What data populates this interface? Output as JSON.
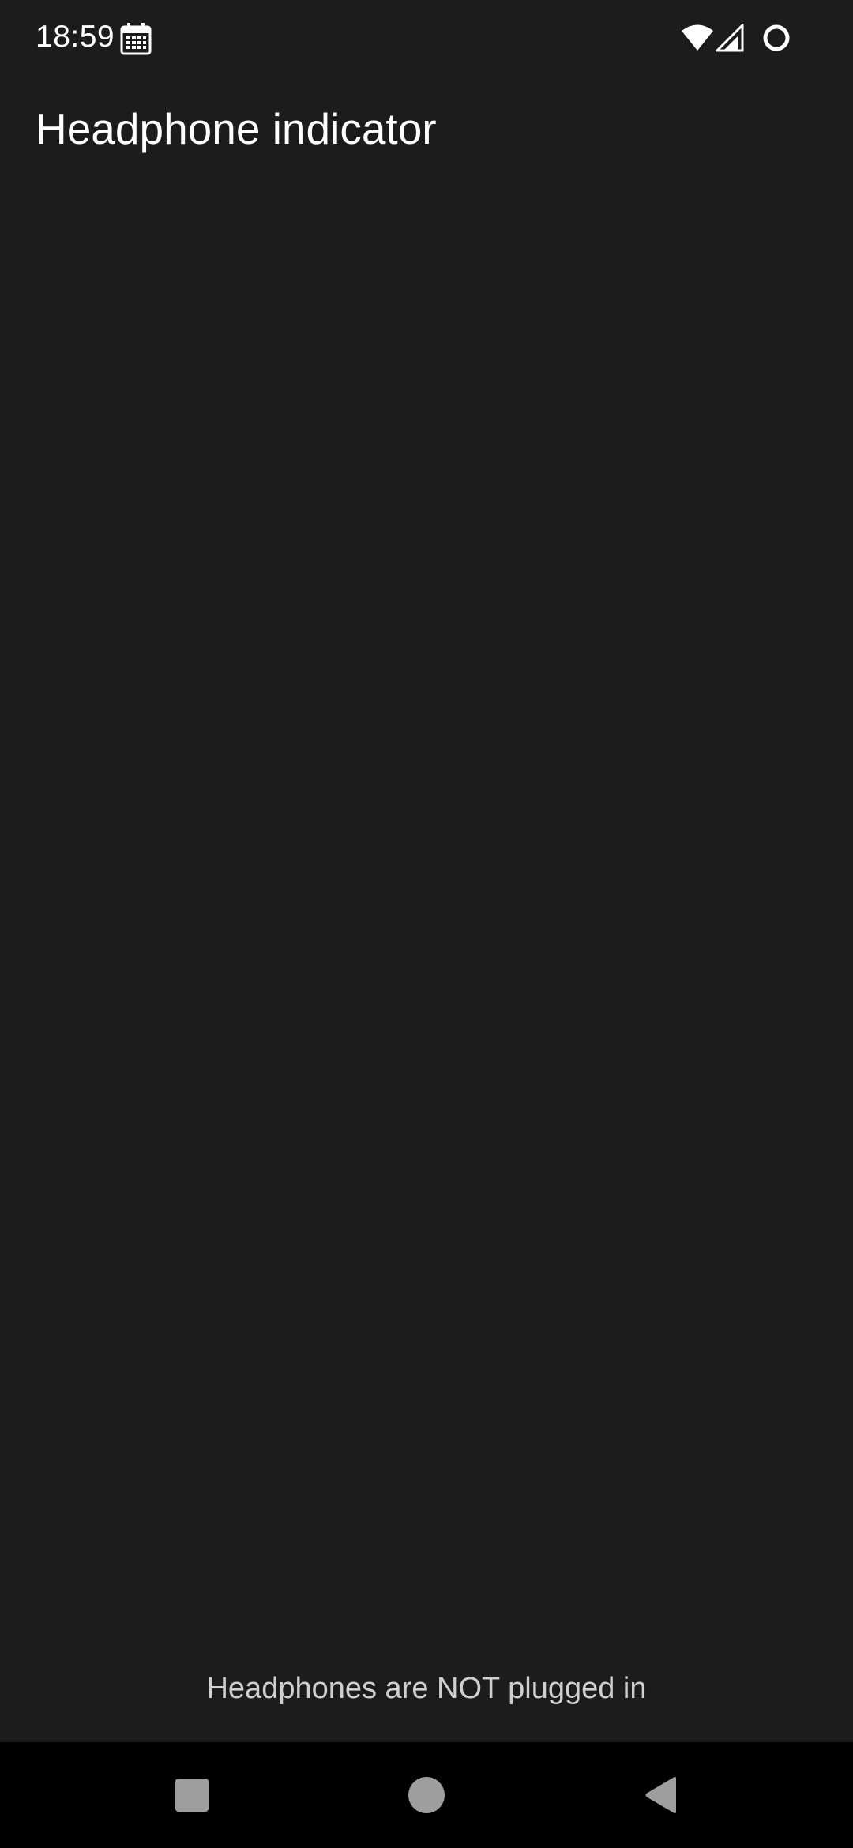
{
  "status_bar": {
    "time": "18:59",
    "icons": [
      "calendar-icon",
      "wifi-icon",
      "signal-icon",
      "battery-icon"
    ]
  },
  "app_bar": {
    "title": "Headphone indicator"
  },
  "main": {
    "status_message": "Headphones are NOT plugged in"
  },
  "nav_bar": {
    "buttons": [
      "recents-icon",
      "home-icon",
      "back-icon"
    ]
  },
  "colors": {
    "background": "#1c1c1c",
    "nav_background": "#000000",
    "text_primary": "#ffffff",
    "text_secondary": "#cfcfcf",
    "nav_icon": "#9e9e9e"
  }
}
